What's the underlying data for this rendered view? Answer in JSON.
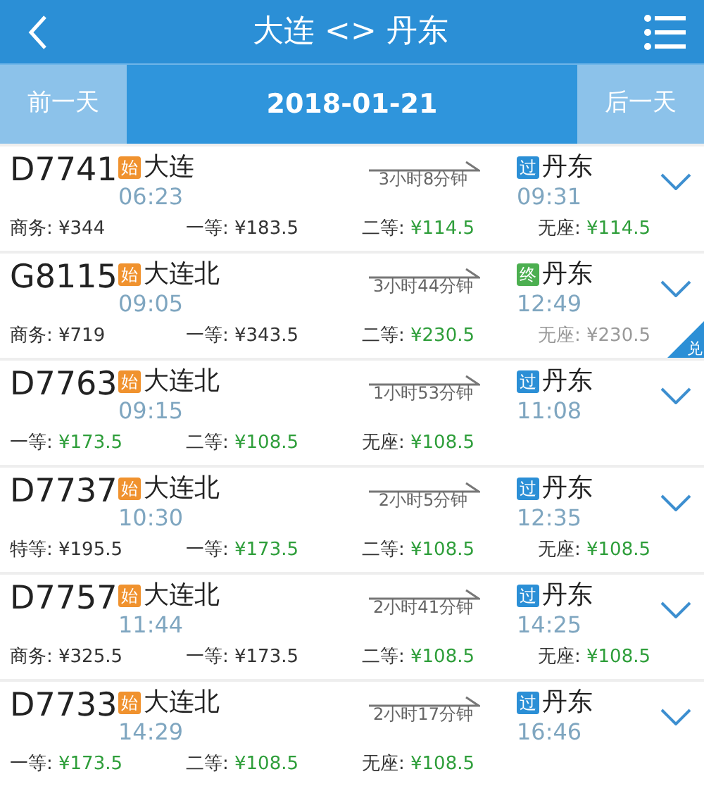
{
  "header": {
    "title": "大连 <> 丹东"
  },
  "date_bar": {
    "prev": "前一天",
    "date": "2018-01-21",
    "next": "后一天"
  },
  "trains": [
    {
      "number": "D7741",
      "from_badge": {
        "text": "始",
        "color": "#f0922e"
      },
      "from": "大连",
      "depart": "06:23",
      "duration": "3小时8分钟",
      "to_badge": {
        "text": "过",
        "color": "#2b8fd6"
      },
      "to": "丹东",
      "arrive": "09:31",
      "fares": [
        {
          "label": "商务:",
          "price": "¥344",
          "kind": "plain"
        },
        {
          "label": "一等:",
          "price": "¥183.5",
          "kind": "plain"
        },
        {
          "label": "二等:",
          "price": "¥114.5",
          "kind": "available"
        },
        {
          "label": "无座:",
          "price": "¥114.5",
          "kind": "available"
        }
      ]
    },
    {
      "number": "G8115",
      "from_badge": {
        "text": "始",
        "color": "#f0922e"
      },
      "from": "大连北",
      "depart": "09:05",
      "duration": "3小时44分钟",
      "to_badge": {
        "text": "终",
        "color": "#4caf50"
      },
      "to": "丹东",
      "arrive": "12:49",
      "fares": [
        {
          "label": "商务:",
          "price": "¥719",
          "kind": "plain"
        },
        {
          "label": "一等:",
          "price": "¥343.5",
          "kind": "plain"
        },
        {
          "label": "二等:",
          "price": "¥230.5",
          "kind": "available"
        },
        {
          "label": "无座:",
          "price": "¥230.5",
          "kind": "disabled"
        }
      ],
      "corner_badge": "兑"
    },
    {
      "number": "D7763",
      "from_badge": {
        "text": "始",
        "color": "#f0922e"
      },
      "from": "大连北",
      "depart": "09:15",
      "duration": "1小时53分钟",
      "to_badge": {
        "text": "过",
        "color": "#2b8fd6"
      },
      "to": "丹东",
      "arrive": "11:08",
      "fares": [
        {
          "label": "一等:",
          "price": "¥173.5",
          "kind": "available"
        },
        {
          "label": "二等:",
          "price": "¥108.5",
          "kind": "available"
        },
        {
          "label": "无座:",
          "price": "¥108.5",
          "kind": "available"
        }
      ]
    },
    {
      "number": "D7737",
      "from_badge": {
        "text": "始",
        "color": "#f0922e"
      },
      "from": "大连北",
      "depart": "10:30",
      "duration": "2小时5分钟",
      "to_badge": {
        "text": "过",
        "color": "#2b8fd6"
      },
      "to": "丹东",
      "arrive": "12:35",
      "fares": [
        {
          "label": "特等:",
          "price": "¥195.5",
          "kind": "plain"
        },
        {
          "label": "一等:",
          "price": "¥173.5",
          "kind": "available"
        },
        {
          "label": "二等:",
          "price": "¥108.5",
          "kind": "available"
        },
        {
          "label": "无座:",
          "price": "¥108.5",
          "kind": "available"
        }
      ]
    },
    {
      "number": "D7757",
      "from_badge": {
        "text": "始",
        "color": "#f0922e"
      },
      "from": "大连北",
      "depart": "11:44",
      "duration": "2小时41分钟",
      "to_badge": {
        "text": "过",
        "color": "#2b8fd6"
      },
      "to": "丹东",
      "arrive": "14:25",
      "fares": [
        {
          "label": "商务:",
          "price": "¥325.5",
          "kind": "plain"
        },
        {
          "label": "一等:",
          "price": "¥173.5",
          "kind": "plain"
        },
        {
          "label": "二等:",
          "price": "¥108.5",
          "kind": "available"
        },
        {
          "label": "无座:",
          "price": "¥108.5",
          "kind": "available"
        }
      ]
    },
    {
      "number": "D7733",
      "from_badge": {
        "text": "始",
        "color": "#f0922e"
      },
      "from": "大连北",
      "depart": "14:29",
      "duration": "2小时17分钟",
      "to_badge": {
        "text": "过",
        "color": "#2b8fd6"
      },
      "to": "丹东",
      "arrive": "16:46",
      "fares": [
        {
          "label": "一等:",
          "price": "¥173.5",
          "kind": "available"
        },
        {
          "label": "二等:",
          "price": "¥108.5",
          "kind": "available"
        },
        {
          "label": "无座:",
          "price": "¥108.5",
          "kind": "available"
        }
      ]
    }
  ]
}
